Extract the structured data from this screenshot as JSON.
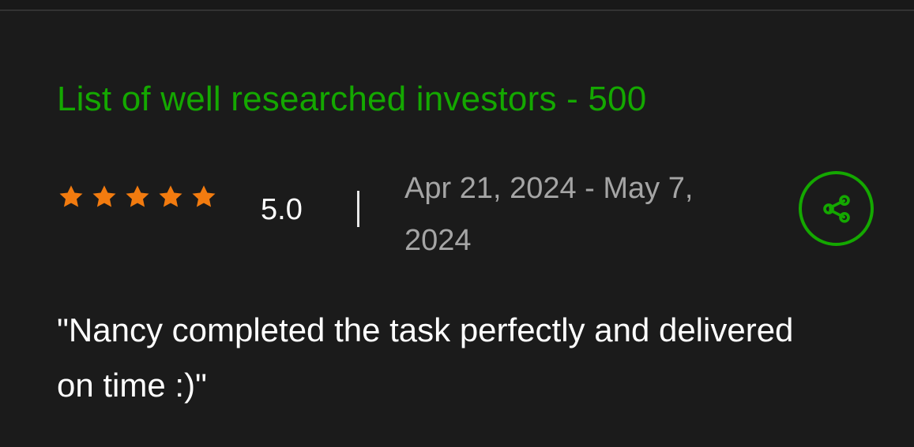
{
  "review": {
    "title": "List of well researched investors - 500",
    "rating": {
      "stars": 5,
      "max_stars": 5,
      "value": "5.0"
    },
    "date_range": "Apr 21, 2024 - May 7, 2024",
    "feedback": "\"Nancy completed the task perfectly and delivered on time :)\""
  },
  "icons": {
    "star": "star-icon",
    "share": "share-icon"
  },
  "colors": {
    "background": "#1b1b1b",
    "title": "#14a800",
    "star": "#f27b0f",
    "share_ring": "#14a800",
    "date_text": "#a5a5a5",
    "body_text": "#ffffff"
  }
}
